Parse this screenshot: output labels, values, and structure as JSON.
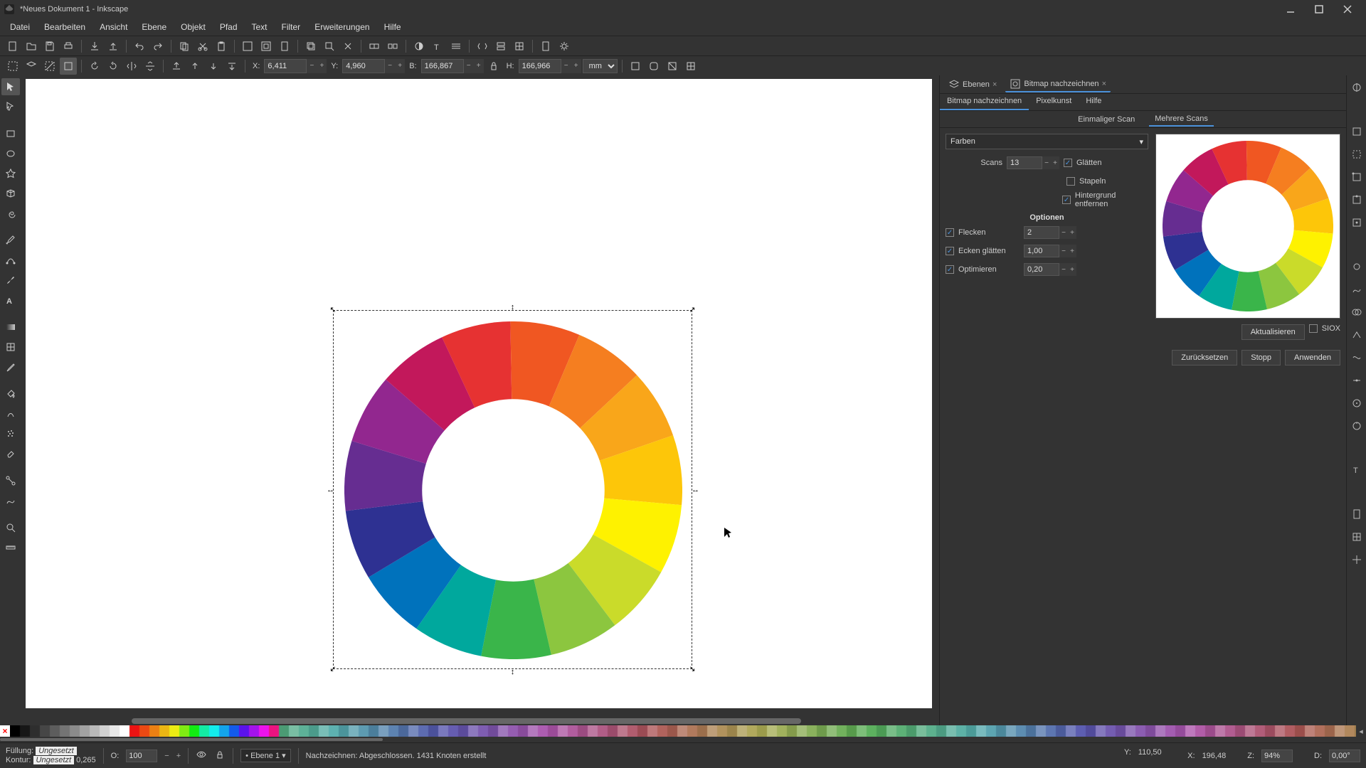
{
  "window": {
    "title": "*Neues Dokument 1 - Inkscape"
  },
  "menu": {
    "items": [
      "Datei",
      "Bearbeiten",
      "Ansicht",
      "Ebene",
      "Objekt",
      "Pfad",
      "Text",
      "Filter",
      "Erweiterungen",
      "Hilfe"
    ]
  },
  "toolbar2": {
    "x_label": "X:",
    "x_value": "6,411",
    "y_label": "Y:",
    "y_value": "4,960",
    "w_label": "B:",
    "w_value": "166,867",
    "h_label": "H:",
    "h_value": "166,966",
    "unit": "mm"
  },
  "panel": {
    "tab_layers": "Ebenen",
    "tab_trace": "Bitmap nachzeichnen",
    "subtab_trace": "Bitmap nachzeichnen",
    "subtab_pixel": "Pixelkunst",
    "subtab_help": "Hilfe",
    "mode_single": "Einmaliger Scan",
    "mode_multi": "Mehrere Scans",
    "dropdown": "Farben",
    "scans_label": "Scans",
    "scans_value": "13",
    "smooth_label": "Glätten",
    "stack_label": "Stapeln",
    "removebg_label": "Hintergrund entfernen",
    "options_title": "Optionen",
    "speckles_label": "Flecken",
    "speckles_value": "2",
    "corners_label": "Ecken glätten",
    "corners_value": "1,00",
    "optimize_label": "Optimieren",
    "optimize_value": "0,20",
    "btn_update": "Aktualisieren",
    "btn_siox": "SIOX",
    "btn_reset": "Zurücksetzen",
    "btn_stop": "Stopp",
    "btn_apply": "Anwenden"
  },
  "status": {
    "fill_label": "Füllung:",
    "fill_value": "Ungesetzt",
    "stroke_label": "Kontur:",
    "stroke_value": "Ungesetzt",
    "stroke_width": "0,265",
    "opacity_label": "O:",
    "opacity_value": "100",
    "layer": "Ebene 1",
    "message": "Nachzeichnen: Abgeschlossen. 1431 Knoten erstellt",
    "coord_x_label": "X:",
    "coord_x": "196,48",
    "coord_y_label": "Y:",
    "coord_y": "110,50",
    "zoom_label": "Z:",
    "zoom": "94%",
    "rotate_label": "D:",
    "rotate": "0,00°"
  },
  "colors": {
    "wheel": [
      "#e63232",
      "#f05722",
      "#f57e20",
      "#f9a61a",
      "#fdc609",
      "#fef200",
      "#cadb2a",
      "#8cc63f",
      "#3ab54a",
      "#00a89d",
      "#0072bc",
      "#2e3192",
      "#662d91",
      "#92278f",
      "#c2185b"
    ]
  }
}
